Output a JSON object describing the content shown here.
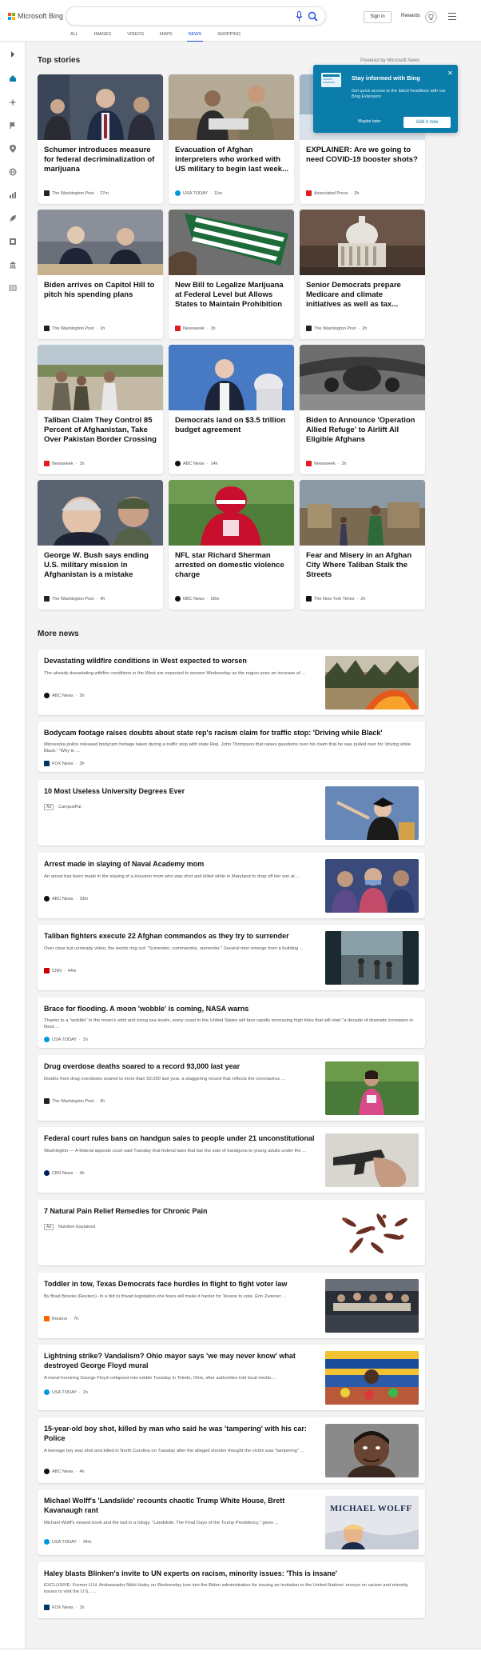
{
  "brand": {
    "logo_text": "Microsoft Bing"
  },
  "header": {
    "signin_label": "Sign in",
    "rewards_label": "Rewards",
    "tabs": [
      {
        "label": "ALL"
      },
      {
        "label": "IMAGES"
      },
      {
        "label": "VIDEOS"
      },
      {
        "label": "MAPS"
      },
      {
        "label": "NEWS",
        "active": true
      },
      {
        "label": "SHOPPING"
      }
    ],
    "icons": [
      "microphone-icon",
      "search-icon",
      "trophy-icon",
      "menu-icon"
    ]
  },
  "sidebar": {
    "icons": [
      "expand-arrow-icon",
      "home-icon",
      "sparkle-icon",
      "flag-icon",
      "location-pin-icon",
      "globe-icon",
      "chart-icon",
      "rocket-icon",
      "film-icon",
      "building-icon",
      "news-icon"
    ]
  },
  "top_stories": {
    "title": "Top stories",
    "powered_by": "Powered by Microsoft News",
    "cards": [
      {
        "title": "Schumer introduces measure for federal decriminalization of marijuana",
        "source": "The Washington Post",
        "age": "27m"
      },
      {
        "title": "Evacuation of Afghan interpreters who worked with US military to begin last week...",
        "source": "USA TODAY",
        "age": "11m"
      },
      {
        "title": "EXPLAINER: Are we going to need COVID-19 booster shots?",
        "source": "Associated Press",
        "age": "2h"
      },
      {
        "title": "Biden arrives on Capitol Hill to pitch his spending plans",
        "source": "The Washington Post",
        "age": "1h"
      },
      {
        "title": "New Bill to Legalize Marijuana at Federal Level but Allows States to Maintain Prohibition",
        "source": "Newsweek",
        "age": "1h"
      },
      {
        "title": "Senior Democrats prepare Medicare and climate initiatives as well as tax...",
        "source": "The Washington Post",
        "age": "2h"
      },
      {
        "title": "Taliban Claim They Control 85 Percent of Afghanistan, Take Over Pakistan Border Crossing",
        "source": "Newsweek",
        "age": "1h"
      },
      {
        "title": "Democrats land on $3.5 trillion budget agreement",
        "source": "ABC News",
        "age": "14h"
      },
      {
        "title": "Biden to Announce 'Operation Allied Refuge' to Airlift All Eligible Afghans",
        "source": "Newsweek",
        "age": "2h"
      },
      {
        "title": "George W. Bush says ending U.S. military mission in Afghanistan is a mistake",
        "source": "The Washington Post",
        "age": "4h"
      },
      {
        "title": "NFL star Richard Sherman arrested on domestic violence charge",
        "source": "NBC News",
        "age": "59m"
      },
      {
        "title": "Fear and Misery in an Afghan City Where Taliban Stalk the Streets",
        "source": "The New York Times",
        "age": "2h"
      }
    ]
  },
  "popup": {
    "title": "Stay informed with Bing",
    "body": "Get quick access to the latest headlines with our Bing Extension",
    "later": "Maybe later",
    "add": "Add it now"
  },
  "more_news": {
    "title": "More news",
    "items": [
      {
        "title": "Devastating wildfire conditions in West expected to worsen",
        "desc": "The already devastating wildfire conditions in the West are expected to worsen Wednesday as the region sees an increase of ...",
        "source": "ABC News",
        "age": "2h"
      },
      {
        "title": "Bodycam footage raises doubts about state rep's racism claim for traffic stop: 'Driving while Black'",
        "desc": "Minnesota police released bodycam footage taken during a traffic stop with state Rep. John Thompson that raises questions over his claim that he was pulled over for 'driving while Black.' \"Why in ...",
        "source": "FOX News",
        "age": "3h"
      },
      {
        "title": "10 Most Useless University Degrees Ever",
        "ad": "Ad",
        "source": "CampusPal"
      },
      {
        "title": "Arrest made in slaying of Naval Academy mom",
        "desc": "An arrest has been made in the slaying of a Houston mom who was shot and killed while in Maryland to drop off her son at ...",
        "source": "ABC News",
        "age": "33m"
      },
      {
        "title": "Taliban fighters execute 22 Afghan commandos as they try to surrender",
        "desc": "Over clear but unsteady video, the words ring out: \"Surrender, commandos, surrender.\" Several men emerge from a building ...",
        "source": "CNN",
        "age": "44m"
      },
      {
        "title": "Brace for flooding. A moon 'wobble' is coming, NASA warns",
        "desc": "Thanks to a \"wobble\" in the moon's orbit and rising sea levels, every coast in the United States will face rapidly increasing high tides that will start \"a decade of dramatic increases in flood ...",
        "source": "USA TODAY",
        "age": "1h"
      },
      {
        "title": "Drug overdose deaths soared to a record 93,000 last year",
        "desc": "Deaths from drug overdoses soared to more than 93,000 last year, a staggering record that reflects the coronavirus ...",
        "source": "The Washington Post",
        "age": "3h"
      },
      {
        "title": "Federal court rules bans on handgun sales to people under 21 unconstitutional",
        "desc": "Washington — A federal appeals court said Tuesday that federal laws that bar the sale of handguns to young adults under the ...",
        "source": "CBS News",
        "age": "4h"
      },
      {
        "title": "7 Natural Pain Relief Remedies for Chronic Pain",
        "ad": "Ad",
        "source": "Nutrition Explained"
      },
      {
        "title": "Toddler in tow, Texas Democrats face hurdles in flight to fight voter law",
        "desc": "By Brad Brooks (Reuters) -In a bid to thwart legislation she fears will make it harder for Texans to vote, Erin Zwiener ...",
        "source": "Reuters",
        "age": "7h"
      },
      {
        "title": "Lightning strike? Vandalism? Ohio mayor says 'we may never know' what destroyed George Floyd mural",
        "desc": "A mural honoring George Floyd collapsed into rubble Tuesday in Toledo, Ohio, after authorities told local media ...",
        "source": "USA TODAY",
        "age": "1h"
      },
      {
        "title": "15-year-old boy shot, killed by man who said he was 'tampering' with his car: Police",
        "desc": "A teenage boy was shot and killed in North Carolina on Tuesday after the alleged shooter thought the victim was \"tampering\" ...",
        "source": "ABC News",
        "age": "4h"
      },
      {
        "title": "Michael Wolff's 'Landslide' recounts chaotic Trump White House, Brett Kavanaugh rant",
        "desc": "Michael Wolff's newest book and the last in a trilogy, \"Landslide: The Final Days of the Trump Presidency,\" gives ...",
        "source": "USA TODAY",
        "age": "34m",
        "img_text": "MICHAEL WOLFF"
      },
      {
        "title": "Haley blasts Blinken's invite to UN experts on racism, minority issues: 'This is insane'",
        "desc": "EXCLUSIVE: Former U.N. Ambassador Nikki Haley on Wednesday tore into the Biden administration for issuing an invitation to the United Nations' envoys on racism and minority issues to visit the U.S., ...",
        "source": "FOX News",
        "age": "1h"
      }
    ]
  },
  "colors": {
    "accent": "#174ae4",
    "popup_bg": "#0b7daa"
  }
}
